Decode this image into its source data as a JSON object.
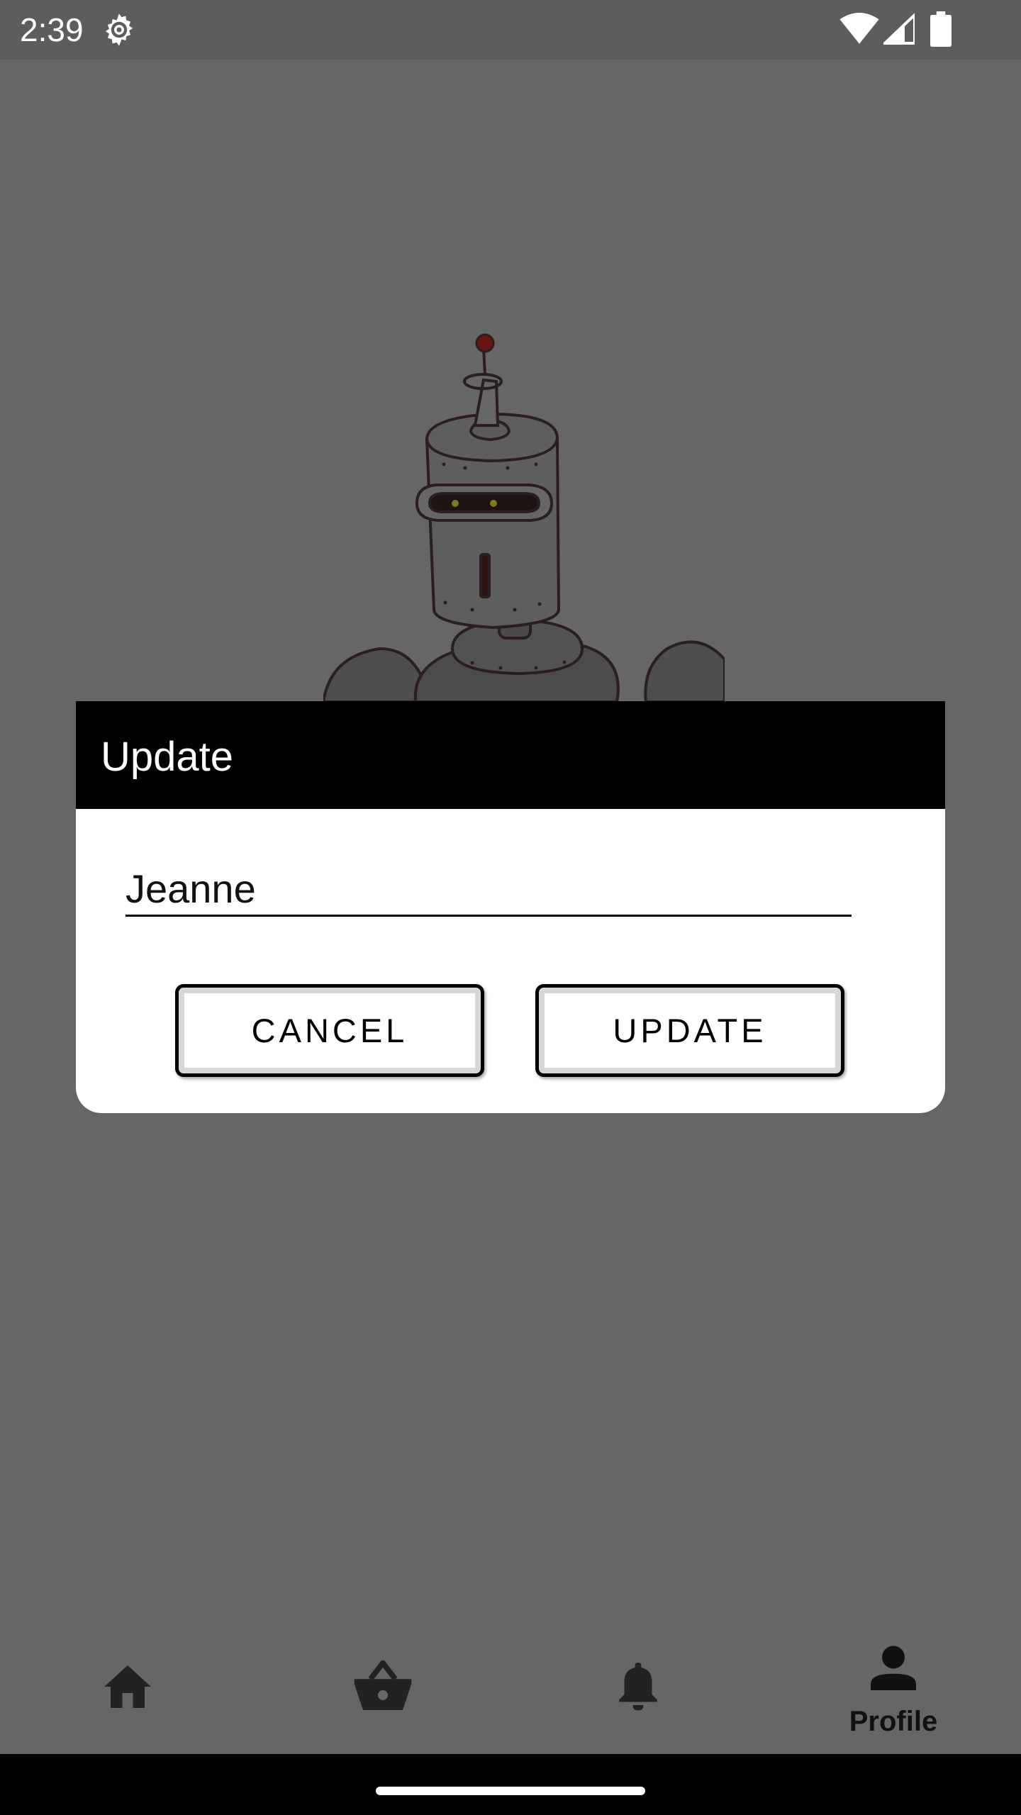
{
  "status_bar": {
    "time": "2:39",
    "icons": [
      "settings-icon",
      "wifi-icon",
      "signal-icon",
      "battery-icon"
    ]
  },
  "dialog": {
    "title": "Update",
    "name_value": "Jeanne",
    "cancel_label": "CANCEL",
    "update_label": "UPDATE"
  },
  "bottom_nav": {
    "items": [
      {
        "icon": "home-icon",
        "label": ""
      },
      {
        "icon": "basket-icon",
        "label": ""
      },
      {
        "icon": "bell-icon",
        "label": ""
      },
      {
        "icon": "person-icon",
        "label": "Profile",
        "selected": true
      }
    ]
  },
  "colors": {
    "scrim": "#666666",
    "dialog_header": "#000000",
    "dialog_body": "#ffffff",
    "nav_icon": "#222222"
  }
}
